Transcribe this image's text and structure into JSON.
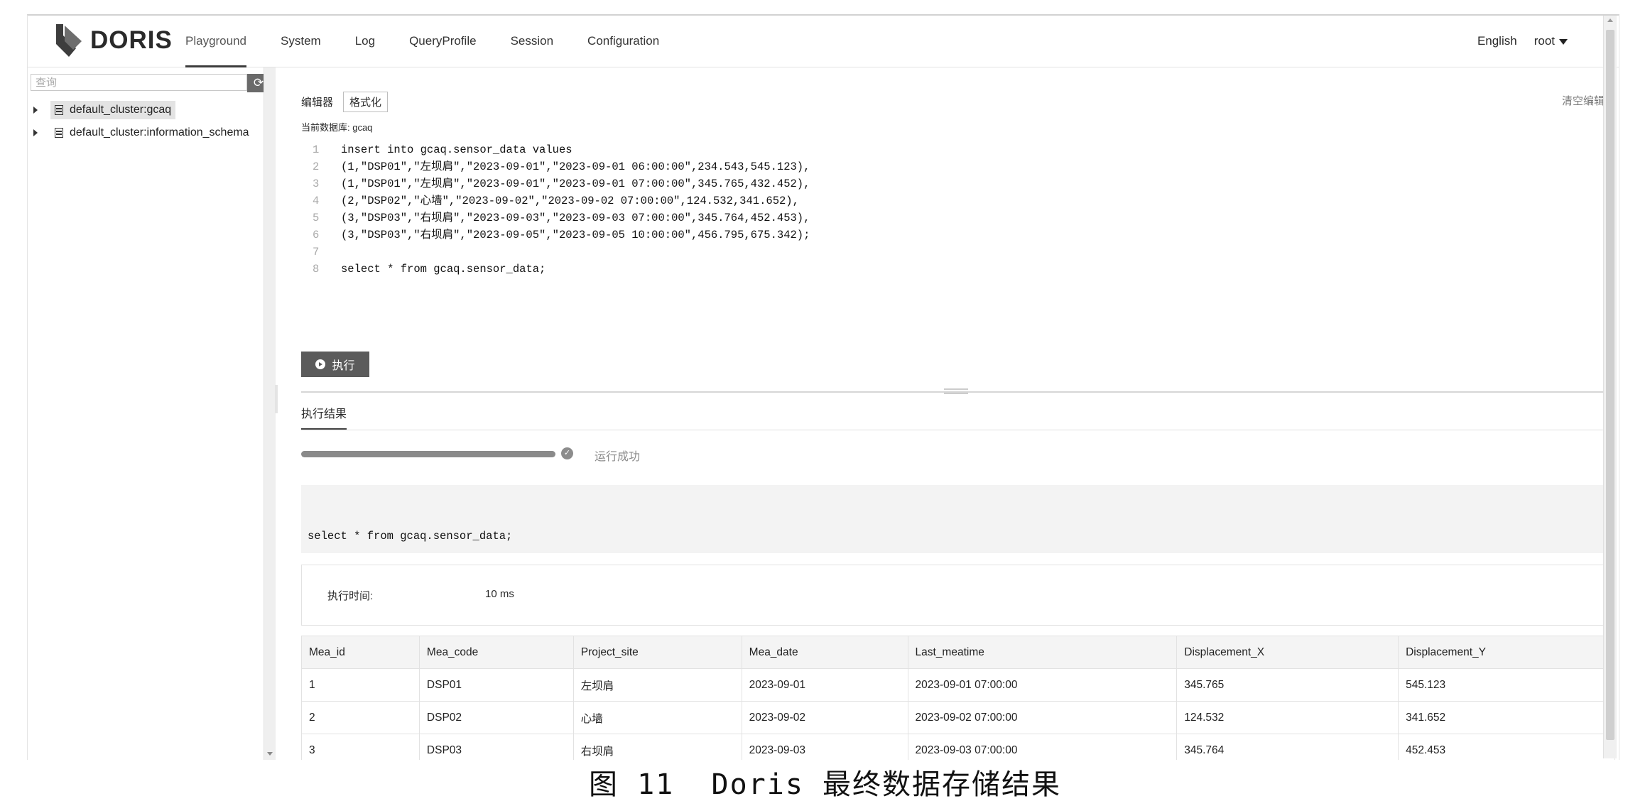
{
  "brand": {
    "name": "DORIS"
  },
  "nav": {
    "items": [
      {
        "label": "Playground"
      },
      {
        "label": "System"
      },
      {
        "label": "Log"
      },
      {
        "label": "QueryProfile"
      },
      {
        "label": "Session"
      },
      {
        "label": "Configuration"
      }
    ],
    "active": "Playground",
    "language": "English",
    "user": "root"
  },
  "sidebar": {
    "search_placeholder": "查询",
    "refresh_icon": "refresh-icon",
    "tree": [
      {
        "label": "default_cluster:gcaq",
        "selected": true
      },
      {
        "label": "default_cluster:information_schema",
        "selected": false
      }
    ]
  },
  "editor": {
    "label": "编辑器",
    "format_button": "格式化",
    "clear_button": "清空编辑器",
    "current_db": "当前数据库: gcaq",
    "lines": [
      {
        "no": "1",
        "text": "insert into gcaq.sensor_data values"
      },
      {
        "no": "2",
        "text": "(1,\"DSP01\",\"左坝肩\",\"2023-09-01\",\"2023-09-01 06:00:00\",234.543,545.123),"
      },
      {
        "no": "3",
        "text": "(1,\"DSP01\",\"左坝肩\",\"2023-09-01\",\"2023-09-01 07:00:00\",345.765,432.452),"
      },
      {
        "no": "4",
        "text": "(2,\"DSP02\",\"心墙\",\"2023-09-02\",\"2023-09-02 07:00:00\",124.532,341.652),"
      },
      {
        "no": "5",
        "text": "(3,\"DSP03\",\"右坝肩\",\"2023-09-03\",\"2023-09-03 07:00:00\",345.764,452.453),"
      },
      {
        "no": "6",
        "text": "(3,\"DSP03\",\"右坝肩\",\"2023-09-05\",\"2023-09-05 10:00:00\",456.795,675.342);"
      },
      {
        "no": "7",
        "text": ""
      },
      {
        "no": "8",
        "text": "select * from gcaq.sensor_data;"
      }
    ],
    "run_button": "执行"
  },
  "result": {
    "tab_label": "执行结果",
    "progress_fraction": 1.0,
    "status": "运行成功",
    "query": "select * from gcaq.sensor_data;",
    "exec_time_label": "执行时间:",
    "exec_time_value": "10 ms",
    "columns": [
      "Mea_id",
      "Mea_code",
      "Project_site",
      "Mea_date",
      "Last_meatime",
      "Displacement_X",
      "Displacement_Y"
    ],
    "rows": [
      [
        "1",
        "DSP01",
        "左坝肩",
        "2023-09-01",
        "2023-09-01 07:00:00",
        "345.765",
        "545.123"
      ],
      [
        "2",
        "DSP02",
        "心墙",
        "2023-09-02",
        "2023-09-02 07:00:00",
        "124.532",
        "341.652"
      ],
      [
        "3",
        "DSP03",
        "右坝肩",
        "2023-09-03",
        "2023-09-03 07:00:00",
        "345.764",
        "452.453"
      ]
    ]
  },
  "caption": {
    "figure": "图 11",
    "text": "Doris 最终数据存储结果"
  }
}
